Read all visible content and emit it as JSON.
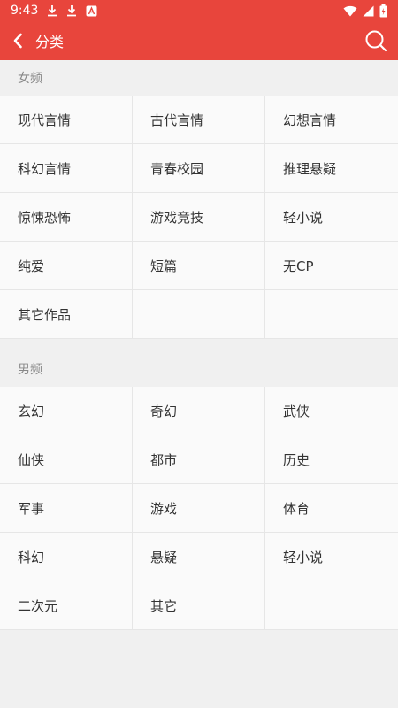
{
  "status": {
    "time": "9:43"
  },
  "header": {
    "title": "分类"
  },
  "sections": [
    {
      "title": "女频",
      "items": [
        "现代言情",
        "古代言情",
        "幻想言情",
        "科幻言情",
        "青春校园",
        "推理悬疑",
        "惊悚恐怖",
        "游戏竞技",
        "轻小说",
        "纯爱",
        "短篇",
        "无CP",
        "其它作品",
        "",
        ""
      ]
    },
    {
      "title": "男频",
      "items": [
        "玄幻",
        "奇幻",
        "武侠",
        "仙侠",
        "都市",
        "历史",
        "军事",
        "游戏",
        "体育",
        "科幻",
        "悬疑",
        "轻小说",
        "二次元",
        "其它",
        ""
      ]
    }
  ],
  "colors": {
    "accent": "#e8453c",
    "background": "#f0f0f0",
    "cell": "#fafafa",
    "text": "#333333",
    "muted": "#888888"
  }
}
